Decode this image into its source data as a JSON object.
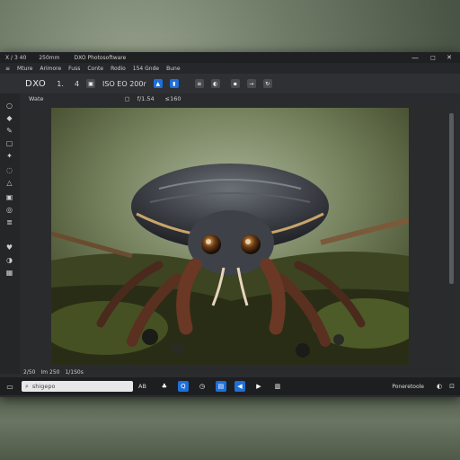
{
  "window": {
    "title_left": "X / 3 40",
    "title_mid": "250mm",
    "title_app": "DXO Photosoftware",
    "controls": [
      "—",
      "□",
      "✕"
    ]
  },
  "menu": [
    "Mture",
    "Arimore",
    "Fuss",
    "Conte",
    "Rodio",
    "154 Gnde",
    "Bune"
  ],
  "toolbar": {
    "logo": "DXO",
    "item_1": "1.",
    "item_2": "4",
    "iso": "ISO EO 200r"
  },
  "subbar": {
    "label": "Wate",
    "aperture": "f/1.54",
    "shutter": "≤160"
  },
  "status": {
    "left": "2/50",
    "mid": "Im 250",
    "right": "1/1S0s"
  },
  "taskbar": {
    "search_placeholder": "shigepo",
    "ai_label": "AB",
    "tray_text": "Poneretoole"
  },
  "colors": {
    "accent": "#1e6fd8",
    "app_bg": "#2b2c2e",
    "taskbar_bg": "#1d1e20"
  },
  "icons": {
    "left_tools": [
      "circle-icon",
      "fill-icon",
      "brush-icon",
      "square-icon",
      "star-icon",
      "lasso-icon",
      "shape-icon",
      "picture-icon",
      "target-icon",
      "layers-icon",
      "heart-icon",
      "adjust-icon",
      "grid-icon"
    ]
  }
}
